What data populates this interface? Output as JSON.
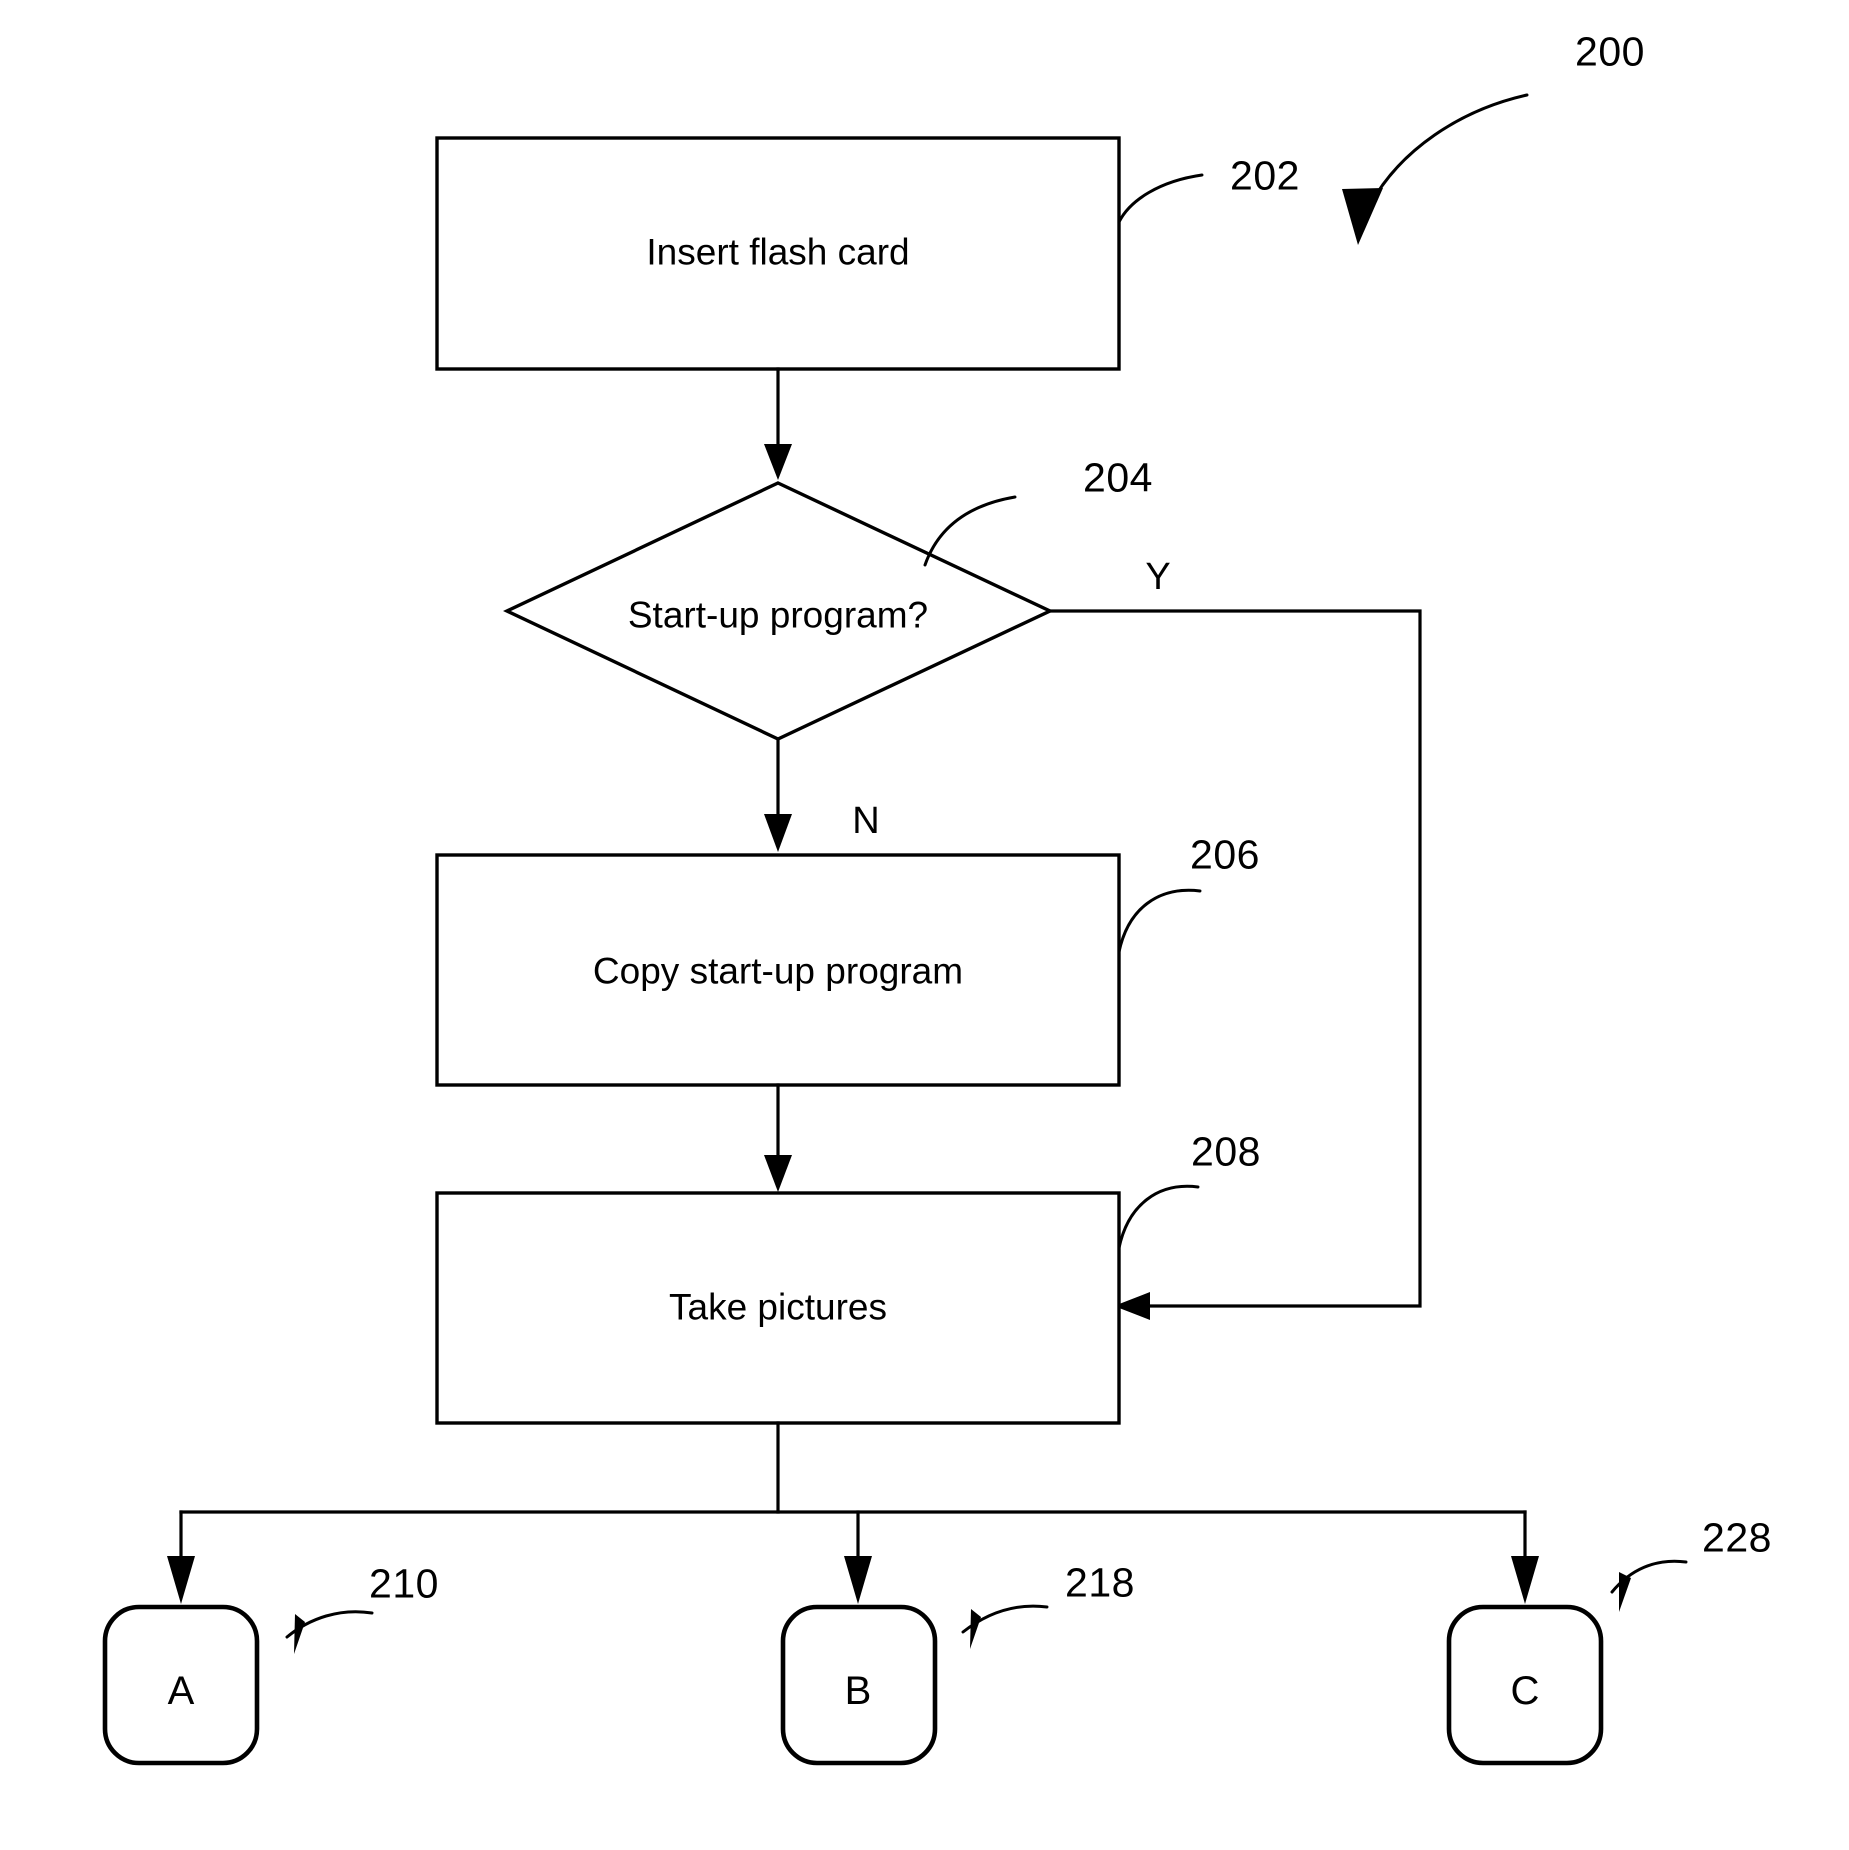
{
  "figure": {
    "number": "200",
    "type": "flowchart"
  },
  "nodes": {
    "insert_flash_card": {
      "text": "Insert flash card",
      "ref": "202",
      "shape": "process"
    },
    "startup_program_decision": {
      "text": "Start-up program?",
      "ref": "204",
      "shape": "decision"
    },
    "copy_startup_program": {
      "text": "Copy start-up program",
      "ref": "206",
      "shape": "process"
    },
    "take_pictures": {
      "text": "Take pictures",
      "ref": "208",
      "shape": "process"
    },
    "connector_a": {
      "text": "A",
      "ref": "210",
      "shape": "connector"
    },
    "connector_b": {
      "text": "B",
      "ref": "218",
      "shape": "connector"
    },
    "connector_c": {
      "text": "C",
      "ref": "228",
      "shape": "connector"
    }
  },
  "branches": {
    "yes": "Y",
    "no": "N"
  },
  "colors": {
    "stroke": "#000000",
    "fill": "#ffffff",
    "background": "#ffffff"
  }
}
